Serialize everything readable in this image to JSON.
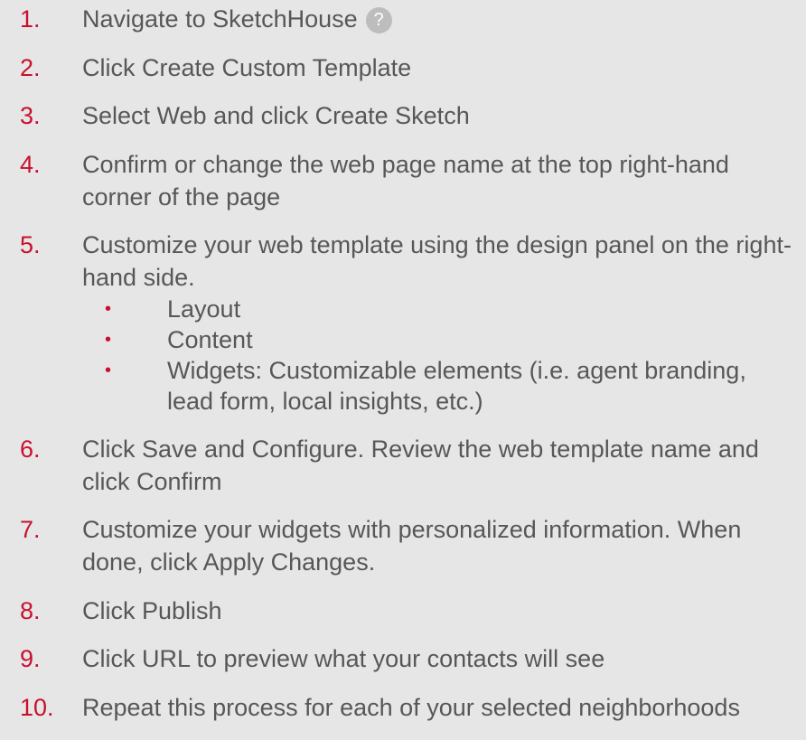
{
  "colors": {
    "background": "#e6e6e6",
    "text": "#575757",
    "accent": "#c8102e",
    "help_icon": "#bdbdbd"
  },
  "steps": [
    {
      "number": "1.",
      "text": "Navigate to SketchHouse",
      "icon": "question-mark-help-icon",
      "icon_glyph": "?"
    },
    {
      "number": "2.",
      "text": "Click Create Custom Template"
    },
    {
      "number": "3.",
      "text": "Select Web and click Create Sketch"
    },
    {
      "number": "4.",
      "text": "Confirm or change the web page name at the top right-hand corner of the page"
    },
    {
      "number": "5.",
      "text": "Customize your web template using the design panel on the right-hand side.",
      "sub_items": [
        {
          "bullet": "•",
          "text": "Layout"
        },
        {
          "bullet": "•",
          "text": "Content"
        },
        {
          "bullet": "•",
          "text": "Widgets: Customizable elements (i.e. agent branding, lead form, local insights, etc.)"
        }
      ]
    },
    {
      "number": "6.",
      "text": "Click Save and Configure. Review the web template name and click Confirm"
    },
    {
      "number": "7.",
      "text": "Customize your widgets with personalized information. When done, click Apply Changes."
    },
    {
      "number": "8.",
      "text": "Click Publish"
    },
    {
      "number": "9.",
      "text": "Click URL to preview what your contacts will see"
    },
    {
      "number": "10.",
      "text": "Repeat this process for each of your selected neighborhoods"
    }
  ]
}
